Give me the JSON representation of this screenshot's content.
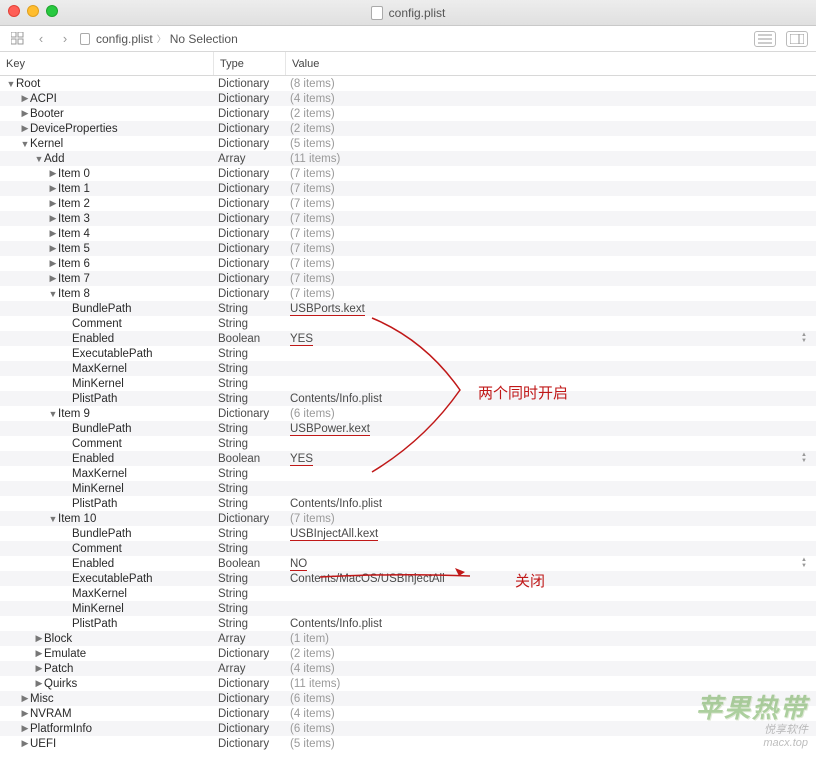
{
  "window": {
    "title": "config.plist"
  },
  "breadcrumb": {
    "file": "config.plist",
    "selection": "No Selection"
  },
  "columns": {
    "key": "Key",
    "type": "Type",
    "value": "Value"
  },
  "rows": [
    {
      "indent": 0,
      "disc": "down",
      "key": "Root",
      "type": "Dictionary",
      "value": "(8 items)",
      "dim": true
    },
    {
      "indent": 1,
      "disc": "right",
      "key": "ACPI",
      "type": "Dictionary",
      "value": "(4 items)",
      "dim": true
    },
    {
      "indent": 1,
      "disc": "right",
      "key": "Booter",
      "type": "Dictionary",
      "value": "(2 items)",
      "dim": true
    },
    {
      "indent": 1,
      "disc": "right",
      "key": "DeviceProperties",
      "type": "Dictionary",
      "value": "(2 items)",
      "dim": true
    },
    {
      "indent": 1,
      "disc": "down",
      "key": "Kernel",
      "type": "Dictionary",
      "value": "(5 items)",
      "dim": true
    },
    {
      "indent": 2,
      "disc": "down",
      "key": "Add",
      "type": "Array",
      "value": "(11 items)",
      "dim": true
    },
    {
      "indent": 3,
      "disc": "right",
      "key": "Item 0",
      "type": "Dictionary",
      "value": "(7 items)",
      "dim": true
    },
    {
      "indent": 3,
      "disc": "right",
      "key": "Item 1",
      "type": "Dictionary",
      "value": "(7 items)",
      "dim": true
    },
    {
      "indent": 3,
      "disc": "right",
      "key": "Item 2",
      "type": "Dictionary",
      "value": "(7 items)",
      "dim": true
    },
    {
      "indent": 3,
      "disc": "right",
      "key": "Item 3",
      "type": "Dictionary",
      "value": "(7 items)",
      "dim": true
    },
    {
      "indent": 3,
      "disc": "right",
      "key": "Item 4",
      "type": "Dictionary",
      "value": "(7 items)",
      "dim": true
    },
    {
      "indent": 3,
      "disc": "right",
      "key": "Item 5",
      "type": "Dictionary",
      "value": "(7 items)",
      "dim": true
    },
    {
      "indent": 3,
      "disc": "right",
      "key": "Item 6",
      "type": "Dictionary",
      "value": "(7 items)",
      "dim": true
    },
    {
      "indent": 3,
      "disc": "right",
      "key": "Item 7",
      "type": "Dictionary",
      "value": "(7 items)",
      "dim": true
    },
    {
      "indent": 3,
      "disc": "down",
      "key": "Item 8",
      "type": "Dictionary",
      "value": "(7 items)",
      "dim": true
    },
    {
      "indent": 4,
      "disc": "",
      "key": "BundlePath",
      "type": "String",
      "value": "USBPorts.kext",
      "dim": false,
      "ul": true
    },
    {
      "indent": 4,
      "disc": "",
      "key": "Comment",
      "type": "String",
      "value": "",
      "dim": false
    },
    {
      "indent": 4,
      "disc": "",
      "key": "Enabled",
      "type": "Boolean",
      "value": "YES",
      "dim": false,
      "stepper": true,
      "ul": true
    },
    {
      "indent": 4,
      "disc": "",
      "key": "ExecutablePath",
      "type": "String",
      "value": "",
      "dim": false
    },
    {
      "indent": 4,
      "disc": "",
      "key": "MaxKernel",
      "type": "String",
      "value": "",
      "dim": false
    },
    {
      "indent": 4,
      "disc": "",
      "key": "MinKernel",
      "type": "String",
      "value": "",
      "dim": false
    },
    {
      "indent": 4,
      "disc": "",
      "key": "PlistPath",
      "type": "String",
      "value": "Contents/Info.plist",
      "dim": false
    },
    {
      "indent": 3,
      "disc": "down",
      "key": "Item 9",
      "type": "Dictionary",
      "value": "(6 items)",
      "dim": true
    },
    {
      "indent": 4,
      "disc": "",
      "key": "BundlePath",
      "type": "String",
      "value": "USBPower.kext",
      "dim": false,
      "ul": true
    },
    {
      "indent": 4,
      "disc": "",
      "key": "Comment",
      "type": "String",
      "value": "",
      "dim": false
    },
    {
      "indent": 4,
      "disc": "",
      "key": "Enabled",
      "type": "Boolean",
      "value": "YES",
      "dim": false,
      "stepper": true,
      "ul": true
    },
    {
      "indent": 4,
      "disc": "",
      "key": "MaxKernel",
      "type": "String",
      "value": "",
      "dim": false
    },
    {
      "indent": 4,
      "disc": "",
      "key": "MinKernel",
      "type": "String",
      "value": "",
      "dim": false
    },
    {
      "indent": 4,
      "disc": "",
      "key": "PlistPath",
      "type": "String",
      "value": "Contents/Info.plist",
      "dim": false
    },
    {
      "indent": 3,
      "disc": "down",
      "key": "Item 10",
      "type": "Dictionary",
      "value": "(7 items)",
      "dim": true
    },
    {
      "indent": 4,
      "disc": "",
      "key": "BundlePath",
      "type": "String",
      "value": "USBInjectAll.kext",
      "dim": false,
      "ul": true
    },
    {
      "indent": 4,
      "disc": "",
      "key": "Comment",
      "type": "String",
      "value": "",
      "dim": false
    },
    {
      "indent": 4,
      "disc": "",
      "key": "Enabled",
      "type": "Boolean",
      "value": "NO",
      "dim": false,
      "stepper": true,
      "ul": true
    },
    {
      "indent": 4,
      "disc": "",
      "key": "ExecutablePath",
      "type": "String",
      "value": "Contents/MacOS/USBInjectAll",
      "dim": false
    },
    {
      "indent": 4,
      "disc": "",
      "key": "MaxKernel",
      "type": "String",
      "value": "",
      "dim": false
    },
    {
      "indent": 4,
      "disc": "",
      "key": "MinKernel",
      "type": "String",
      "value": "",
      "dim": false
    },
    {
      "indent": 4,
      "disc": "",
      "key": "PlistPath",
      "type": "String",
      "value": "Contents/Info.plist",
      "dim": false
    },
    {
      "indent": 2,
      "disc": "right",
      "key": "Block",
      "type": "Array",
      "value": "(1 item)",
      "dim": true
    },
    {
      "indent": 2,
      "disc": "right",
      "key": "Emulate",
      "type": "Dictionary",
      "value": "(2 items)",
      "dim": true
    },
    {
      "indent": 2,
      "disc": "right",
      "key": "Patch",
      "type": "Array",
      "value": "(4 items)",
      "dim": true
    },
    {
      "indent": 2,
      "disc": "right",
      "key": "Quirks",
      "type": "Dictionary",
      "value": "(11 items)",
      "dim": true
    },
    {
      "indent": 1,
      "disc": "right",
      "key": "Misc",
      "type": "Dictionary",
      "value": "(6 items)",
      "dim": true
    },
    {
      "indent": 1,
      "disc": "right",
      "key": "NVRAM",
      "type": "Dictionary",
      "value": "(4 items)",
      "dim": true
    },
    {
      "indent": 1,
      "disc": "right",
      "key": "PlatformInfo",
      "type": "Dictionary",
      "value": "(6 items)",
      "dim": true
    },
    {
      "indent": 1,
      "disc": "right",
      "key": "UEFI",
      "type": "Dictionary",
      "value": "(5 items)",
      "dim": true
    }
  ],
  "annotations": {
    "note1": "两个同时开启",
    "note2": "关闭"
  },
  "watermark": {
    "line1": "苹果热带",
    "line2": "悦享软件",
    "line3": "macx.top"
  }
}
